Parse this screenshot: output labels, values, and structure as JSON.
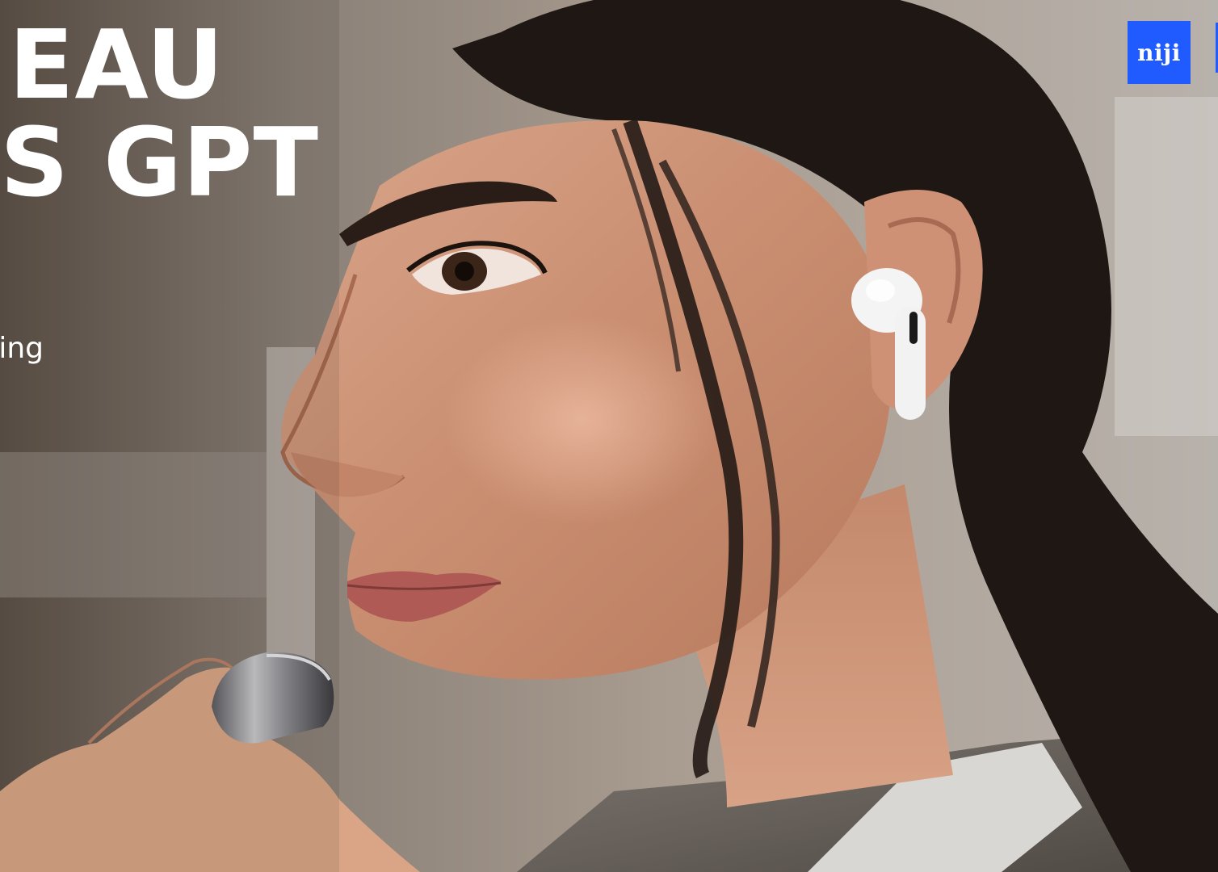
{
  "headline": {
    "line1": "ANNEAU",
    "line2": "SELLES GPT"
  },
  "subline": "Smart ring",
  "logo": {
    "text": "niji",
    "color": "#1f5bff"
  },
  "scene": {
    "earbud_color": "#f4f4f4",
    "ring_color": "#9a9a9c"
  }
}
